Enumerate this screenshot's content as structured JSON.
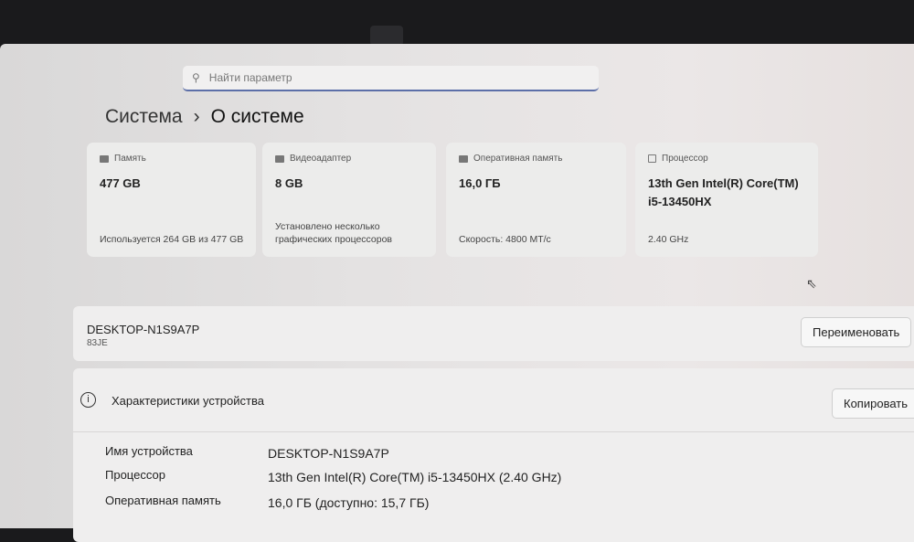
{
  "search": {
    "placeholder": "Найти параметр"
  },
  "breadcrumb": {
    "parent": "Система",
    "separator": "›",
    "current": "О системе"
  },
  "cards": [
    {
      "label": "Память",
      "value": "477 GB",
      "sub": "Используется 264 GB из 477 GB"
    },
    {
      "label": "Видеоадаптер",
      "value": "8 GB",
      "sub": "Установлено несколько графических процессоров"
    },
    {
      "label": "Оперативная память",
      "value": "16,0 ГБ",
      "sub": "Скорость: 4800 МТ/с"
    },
    {
      "label": "Процессор",
      "value": "13th Gen Intel(R) Core(TM) i5-13450HX",
      "sub": "2.40 GHz"
    }
  ],
  "device": {
    "name": "DESKTOP-N1S9A7P",
    "model": "83JE",
    "rename": "Переименовать"
  },
  "specs": {
    "title": "Характеристики устройства",
    "copy": "Копировать",
    "rows": [
      {
        "label": "Имя устройства",
        "value": "DESKTOP-N1S9A7P"
      },
      {
        "label": "Процессор",
        "value": "13th Gen Intel(R) Core(TM) i5-13450HX (2.40 GHz)"
      },
      {
        "label": "Оперативная память",
        "value": "16,0 ГБ (доступно: 15,7 ГБ)"
      }
    ]
  }
}
